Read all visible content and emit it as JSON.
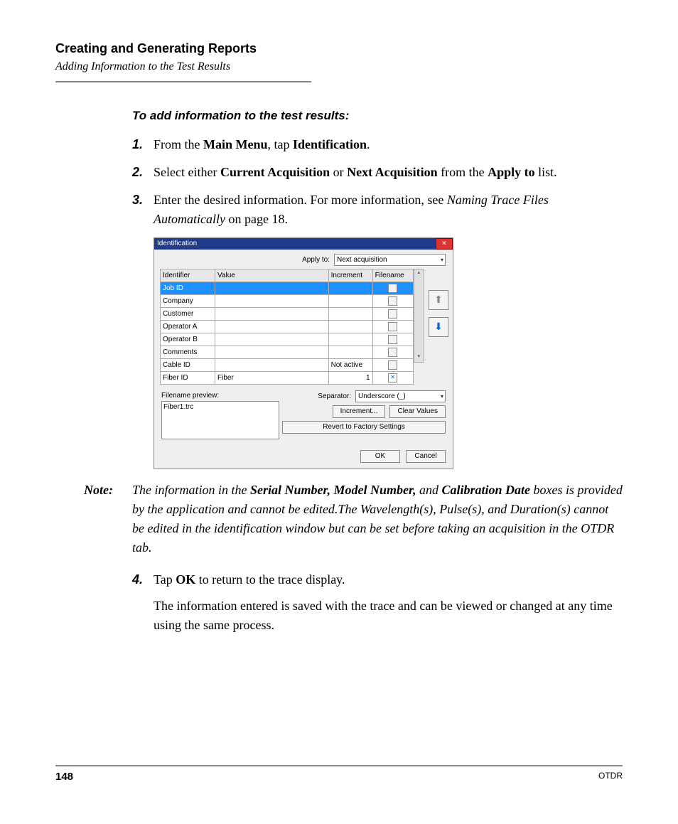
{
  "header": {
    "chapter": "Creating and Generating Reports",
    "subtitle": "Adding Information to the Test Results"
  },
  "lead": "To add information to the test results:",
  "steps": {
    "n1": "1.",
    "s1a": "From the ",
    "s1b": "Main Menu",
    "s1c": ", tap ",
    "s1d": "Identification",
    "s1e": ".",
    "n2": "2.",
    "s2a": "Select either ",
    "s2b": "Current Acquisition",
    "s2c": " or ",
    "s2d": "Next Acquisition",
    "s2e": " from the ",
    "s2f": "Apply to",
    "s2g": " list.",
    "n3": "3.",
    "s3a": "Enter the desired information. For more information, see ",
    "s3b": "Naming Trace Files Automatically",
    "s3c": " on page 18.",
    "n4": "4.",
    "s4a": "Tap ",
    "s4b": "OK",
    "s4c": " to return to the trace display.",
    "s4para": "The information entered is saved with the trace and can be viewed or changed at any time using the same process."
  },
  "note": {
    "label": "Note:",
    "a": "The information in the ",
    "b": "Serial Number, Model Number,",
    "c": " and ",
    "d": "Calibration Date",
    "e": " boxes is provided by the application and cannot be edited.The Wavelength(s), Pulse(s), and Duration(s) cannot be edited in the identification window but can be set before taking an acquisition in the OTDR tab."
  },
  "dialog": {
    "title": "Identification",
    "apply_label": "Apply to:",
    "apply_value": "Next acquisition",
    "cols": {
      "id": "Identifier",
      "val": "Value",
      "inc": "Increment",
      "fn": "Filename"
    },
    "rows": [
      {
        "id": "Job ID",
        "val": "",
        "inc": "",
        "fn": false
      },
      {
        "id": "Company",
        "val": "",
        "inc": "",
        "fn": false
      },
      {
        "id": "Customer",
        "val": "",
        "inc": "",
        "fn": false
      },
      {
        "id": "Operator A",
        "val": "",
        "inc": "",
        "fn": false
      },
      {
        "id": "Operator B",
        "val": "",
        "inc": "",
        "fn": false
      },
      {
        "id": "Comments",
        "val": "",
        "inc": "",
        "fn": false
      },
      {
        "id": "Cable ID",
        "val": "",
        "inc": "Not active",
        "fn": false
      },
      {
        "id": "Fiber ID",
        "val": "Fiber",
        "inc": "1",
        "fn": true
      }
    ],
    "fp_label": "Filename preview:",
    "fp_value": "Fiber1.trc",
    "sep_label": "Separator:",
    "sep_value": "Underscore (_)",
    "btn_inc": "Increment...",
    "btn_clear": "Clear Values",
    "btn_revert": "Revert to Factory Settings",
    "btn_ok": "OK",
    "btn_cancel": "Cancel"
  },
  "footer": {
    "page": "148",
    "product": "OTDR"
  }
}
